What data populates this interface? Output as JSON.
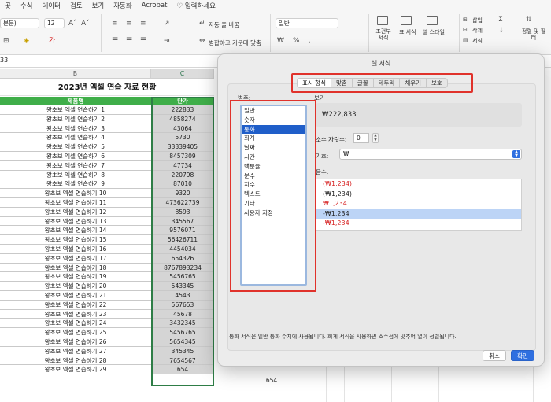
{
  "ribbon": {
    "menu": [
      "곳",
      "수식",
      "데이터",
      "검토",
      "보기",
      "자동화",
      "Acrobat",
      "입력하세요"
    ],
    "font_name": "본문)",
    "font_size": "12",
    "wrap_text": "자동 줄 바꿈",
    "merge_center": "병합하고 가운데 맞춤",
    "number_format": "일반",
    "conditional": "조건부 서식",
    "as_table": "표 서식",
    "cell_styles": "셀 스타일",
    "insert": "삽입",
    "delete": "삭제",
    "format": "서식",
    "sort_filter": "정렬 및 필터"
  },
  "formula_bar": {
    "cell_ref": "33"
  },
  "sheet": {
    "columns": [
      "B",
      "C"
    ],
    "title": "2023년 엑셀 연습 자료 현황",
    "header_product": "제품명",
    "header_price": "단가",
    "rows": [
      {
        "name": "왕초보 엑셀 연습하기 1",
        "price": "222833"
      },
      {
        "name": "왕초보 엑셀 연습하기 2",
        "price": "4858274"
      },
      {
        "name": "왕초보 엑셀 연습하기 3",
        "price": "43064"
      },
      {
        "name": "왕초보 엑셀 연습하기 4",
        "price": "5730"
      },
      {
        "name": "왕초보 엑셀 연습하기 5",
        "price": "33339405"
      },
      {
        "name": "왕초보 엑셀 연습하기 6",
        "price": "8457309"
      },
      {
        "name": "왕초보 엑셀 연습하기 7",
        "price": "47734"
      },
      {
        "name": "왕초보 엑셀 연습하기 8",
        "price": "220798"
      },
      {
        "name": "왕초보 엑셀 연습하기 9",
        "price": "87010"
      },
      {
        "name": "왕초보 엑셀 연습하기 10",
        "price": "9320"
      },
      {
        "name": "왕초보 엑셀 연습하기 11",
        "price": "473622739"
      },
      {
        "name": "왕초보 엑셀 연습하기 12",
        "price": "8593"
      },
      {
        "name": "왕초보 엑셀 연습하기 13",
        "price": "345567"
      },
      {
        "name": "왕초보 엑셀 연습하기 14",
        "price": "9576071"
      },
      {
        "name": "왕초보 엑셀 연습하기 15",
        "price": "56426711"
      },
      {
        "name": "왕초보 엑셀 연습하기 16",
        "price": "4454034"
      },
      {
        "name": "왕초보 엑셀 연습하기 17",
        "price": "654326"
      },
      {
        "name": "왕초보 엑셀 연습하기 18",
        "price": "8767893234"
      },
      {
        "name": "왕초보 엑셀 연습하기 19",
        "price": "5456765"
      },
      {
        "name": "왕초보 엑셀 연습하기 20",
        "price": "543345"
      },
      {
        "name": "왕초보 엑셀 연습하기 21",
        "price": "4543"
      },
      {
        "name": "왕초보 엑셀 연습하기 22",
        "price": "567653"
      },
      {
        "name": "왕초보 엑셀 연습하기 23",
        "price": "45678"
      },
      {
        "name": "왕초보 엑셀 연습하기 24",
        "price": "3432345"
      },
      {
        "name": "왕초보 엑셀 연습하기 25",
        "price": "5456765"
      },
      {
        "name": "왕초보 엑셀 연습하기 26",
        "price": "5654345"
      },
      {
        "name": "왕초보 엑셀 연습하기 27",
        "price": "345345"
      },
      {
        "name": "왕초보 엑셀 연습하기 28",
        "price": "7654567"
      },
      {
        "name": "왕초보 엑셀 연습하기 29",
        "price": "654"
      }
    ],
    "below_value": "654"
  },
  "dialog": {
    "title": "셀 서식",
    "tabs": [
      "표시 형식",
      "맞춤",
      "글꼴",
      "테두리",
      "채우기",
      "보호"
    ],
    "active_tab": "표시 형식",
    "category_label": "범주:",
    "categories": [
      "일반",
      "숫자",
      "통화",
      "회계",
      "날짜",
      "시간",
      "백분율",
      "분수",
      "지수",
      "텍스트",
      "기타",
      "사용자 지정"
    ],
    "selected_category": "통화",
    "sample_label": "보기",
    "sample_value": "₩222,833",
    "decimal_label": "소수 자릿수:",
    "decimal_value": "0",
    "symbol_label": "기호:",
    "symbol_value": "₩",
    "negative_label": "음수:",
    "negatives": [
      {
        "text": "(₩1,234)",
        "red": true
      },
      {
        "text": "(₩1,234)",
        "red": false
      },
      {
        "text": "₩1,234",
        "red": true
      },
      {
        "text": "-₩1,234",
        "red": false,
        "selected": true
      },
      {
        "text": "-₩1,234",
        "red": true
      }
    ],
    "description": "통화 서식은 일반 통화 수치에 사용됩니다. 회계 서식을 사용하면 소수점에 맞추어 열이 정렬됩니다.",
    "cancel": "취소",
    "ok": "확인"
  },
  "colors": {
    "header_green": "#3fae49",
    "selection_blue": "#1f5ec9",
    "highlight_red": "#e0322b",
    "primary_button": "#2f6fe0"
  }
}
